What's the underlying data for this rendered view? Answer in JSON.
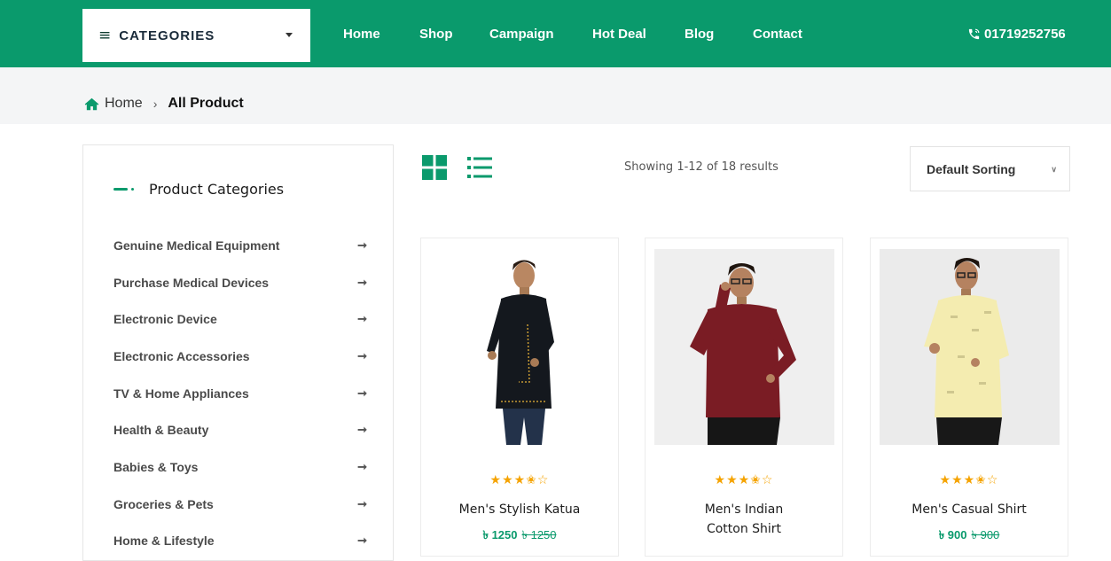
{
  "nav": {
    "categories_label": "CATEGORIES",
    "links": [
      "Home",
      "Shop",
      "Campaign",
      "Hot Deal",
      "Blog",
      "Contact"
    ],
    "phone": "01719252756"
  },
  "breadcrumb": {
    "home": "Home",
    "separator": "›",
    "current": "All Product"
  },
  "sidebar": {
    "title": "Product Categories",
    "items": [
      "Genuine Medical Equipment",
      "Purchase Medical Devices",
      "Electronic Device",
      "Electronic Accessories",
      "TV & Home Appliances",
      "Health & Beauty",
      "Babies & Toys",
      "Groceries & Pets",
      "Home & Lifestyle"
    ]
  },
  "toolbar": {
    "showing": "Showing 1-12 of 18 results",
    "sort": "Default Sorting"
  },
  "products": [
    {
      "name": "Men's Stylish Katua",
      "price": "৳ 1250",
      "old_price": "৳ 1250",
      "rating": 3.5,
      "stars": "★★★✬☆"
    },
    {
      "name_line1": "Men's Indian",
      "name_line2": "Cotton Shirt",
      "rating": 3.5,
      "stars": "★★★✬☆"
    },
    {
      "name": "Men's Casual Shirt",
      "price": "৳ 900",
      "old_price": "৳ 900",
      "rating": 3.5,
      "stars": "★★★✬☆"
    }
  ],
  "colors": {
    "brand_green": "#0a9a6c",
    "star": "#f5a300",
    "breadcrumb_bg": "#f4f5f6"
  },
  "icons": [
    "menu-icon",
    "caret-down-icon",
    "phone-icon",
    "home-icon",
    "arrow-right-icon",
    "grid-view-icon",
    "list-view-icon",
    "chevron-down-icon",
    "star-icon"
  ]
}
